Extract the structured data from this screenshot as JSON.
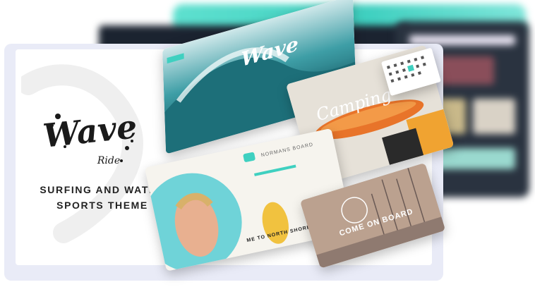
{
  "brand": {
    "logo_main": "Wave",
    "logo_sub": "Ride",
    "tagline_line1": "SURFING AND WATER",
    "tagline_line2": "SPORTS THEME"
  },
  "previews": {
    "wave_title": "Wave",
    "camping_title": "Camping",
    "beach_caption": "ME TO NORTH SHORE",
    "harbor_title": "COME ON BOARD",
    "beach_menu_title": "NORMANS BOARD"
  },
  "colors": {
    "teal": "#3fd0c0",
    "dark": "#1b2330",
    "card_bg": "#e9ebf7",
    "accent_orange": "#f0a331"
  }
}
